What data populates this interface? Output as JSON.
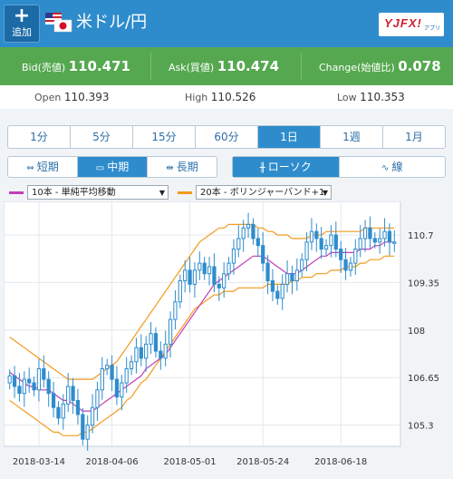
{
  "header": {
    "add_label": "追加",
    "pair_title": "米ドル/円",
    "brand_text": "YJFX!",
    "brand_sub": "アプリ",
    "bg": "#2e8ccc"
  },
  "quotes": {
    "bid_label": "Bid(売値)",
    "bid_value": "110.471",
    "ask_label": "Ask(買値)",
    "ask_value": "110.474",
    "change_label": "Change(始値比)",
    "change_value": "0.078",
    "bg": "#55a84f"
  },
  "stats": {
    "open_label": "Open",
    "open_value": "110.393",
    "high_label": "High",
    "high_value": "110.526",
    "low_label": "Low",
    "low_value": "110.353"
  },
  "timeframes": [
    "1分",
    "5分",
    "15分",
    "60分",
    "1日",
    "1週",
    "1月"
  ],
  "active_timeframe": "1日",
  "periods": [
    "短期",
    "中期",
    "長期"
  ],
  "active_period": "中期",
  "chart_styles": [
    "ローソク",
    "線"
  ],
  "active_chart_style": "ローソク",
  "indicators": {
    "ma": {
      "label": "10本 - 単純平均移動",
      "color": "#c03fb7"
    },
    "bb": {
      "label": "20本 - ボリンジャーバンド+1",
      "color": "#f39a1e"
    }
  },
  "chart_data": {
    "type": "candlestick",
    "x_ticks": [
      "2018-03-14",
      "2018-04-06",
      "2018-05-01",
      "2018-05-24",
      "2018-06-18"
    ],
    "y_ticks": [
      110.7,
      109.35,
      108,
      106.65,
      105.3
    ],
    "y_tick_labels": [
      "110.7",
      "109.35",
      "108",
      "106.65",
      "105.3"
    ],
    "ylim": [
      104.8,
      111.5
    ],
    "up_color": "#2e8ccc",
    "down_color": "#2e8ccc",
    "closes": [
      106.7,
      106.4,
      106.2,
      106.6,
      106.5,
      106.3,
      106.9,
      106.6,
      106.2,
      105.8,
      105.5,
      105.9,
      106.4,
      106.0,
      105.6,
      104.9,
      105.3,
      105.8,
      106.3,
      106.9,
      107.0,
      106.6,
      106.1,
      106.5,
      106.9,
      107.1,
      107.5,
      107.2,
      107.6,
      107.9,
      107.4,
      107.2,
      107.6,
      108.3,
      108.8,
      109.4,
      109.7,
      109.3,
      109.7,
      109.9,
      109.6,
      109.8,
      109.3,
      109.2,
      109.6,
      109.9,
      110.3,
      110.6,
      110.9,
      111.0,
      110.6,
      110.4,
      109.9,
      109.4,
      109.1,
      108.9,
      109.3,
      109.6,
      109.4,
      109.7,
      110.0,
      110.5,
      110.8,
      110.6,
      110.3,
      110.4,
      110.7,
      110.3,
      110.0,
      109.7,
      109.9,
      110.3,
      110.6,
      110.9,
      110.6,
      110.5,
      110.6,
      110.8,
      110.5,
      110.5
    ],
    "ma10": [
      106.8,
      106.7,
      106.6,
      106.5,
      106.4,
      106.4,
      106.3,
      106.3,
      106.3,
      106.2,
      106.1,
      106.0,
      106.0,
      105.9,
      105.8,
      105.7,
      105.7,
      105.7,
      105.8,
      105.9,
      106.0,
      106.1,
      106.2,
      106.3,
      106.4,
      106.5,
      106.6,
      106.7,
      106.9,
      107.0,
      107.1,
      107.2,
      107.3,
      107.5,
      107.7,
      107.9,
      108.1,
      108.3,
      108.5,
      108.7,
      108.9,
      109.1,
      109.3,
      109.4,
      109.5,
      109.6,
      109.7,
      109.8,
      109.9,
      110.0,
      110.1,
      110.1,
      110.1,
      110.0,
      109.9,
      109.8,
      109.7,
      109.6,
      109.6,
      109.6,
      109.7,
      109.8,
      109.9,
      110.0,
      110.1,
      110.1,
      110.2,
      110.2,
      110.2,
      110.2,
      110.2,
      110.2,
      110.3,
      110.3,
      110.3,
      110.4,
      110.4,
      110.5,
      110.5,
      110.5
    ],
    "bb_upper": [
      107.8,
      107.7,
      107.6,
      107.5,
      107.4,
      107.3,
      107.2,
      107.1,
      107.0,
      106.9,
      106.8,
      106.7,
      106.6,
      106.6,
      106.6,
      106.6,
      106.6,
      106.6,
      106.7,
      106.8,
      106.9,
      107.0,
      107.1,
      107.3,
      107.5,
      107.7,
      107.9,
      108.1,
      108.3,
      108.5,
      108.7,
      108.9,
      109.1,
      109.3,
      109.5,
      109.7,
      109.9,
      110.1,
      110.3,
      110.5,
      110.6,
      110.7,
      110.8,
      110.9,
      110.9,
      111.0,
      111.0,
      111.0,
      111.0,
      111.0,
      111.0,
      110.9,
      110.9,
      110.8,
      110.8,
      110.7,
      110.7,
      110.7,
      110.6,
      110.6,
      110.6,
      110.6,
      110.7,
      110.7,
      110.7,
      110.8,
      110.8,
      110.8,
      110.8,
      110.8,
      110.8,
      110.8,
      110.8,
      110.9,
      110.9,
      110.9,
      110.9,
      110.9,
      110.9,
      110.9
    ],
    "bb_lower": [
      106.0,
      105.9,
      105.8,
      105.7,
      105.6,
      105.5,
      105.4,
      105.3,
      105.2,
      105.1,
      105.1,
      105.0,
      105.0,
      105.0,
      105.0,
      105.1,
      105.1,
      105.2,
      105.3,
      105.4,
      105.5,
      105.6,
      105.7,
      105.8,
      106.0,
      106.1,
      106.3,
      106.5,
      106.6,
      106.8,
      107.0,
      107.2,
      107.4,
      107.6,
      107.8,
      108.0,
      108.2,
      108.4,
      108.6,
      108.7,
      108.8,
      108.9,
      109.0,
      109.0,
      109.1,
      109.1,
      109.1,
      109.2,
      109.2,
      109.2,
      109.2,
      109.2,
      109.2,
      109.3,
      109.3,
      109.3,
      109.3,
      109.3,
      109.4,
      109.4,
      109.5,
      109.5,
      109.5,
      109.6,
      109.6,
      109.6,
      109.7,
      109.7,
      109.7,
      109.8,
      109.8,
      109.8,
      109.9,
      109.9,
      110.0,
      110.0,
      110.0,
      110.1,
      110.1,
      110.1
    ]
  }
}
